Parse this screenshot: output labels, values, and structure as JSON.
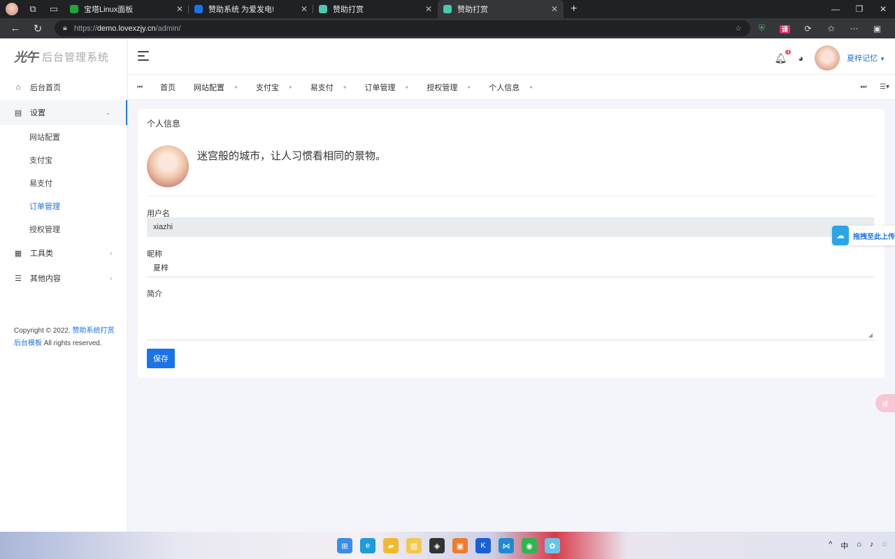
{
  "browser": {
    "tabs": [
      {
        "label": "宝塔Linux面板",
        "favicon_color": "#20a53a",
        "active": false
      },
      {
        "label": "赞助系统 为爱发电!",
        "favicon_color": "#1a73e8",
        "active": false
      },
      {
        "label": "赞助打赏",
        "favicon_color": "#48c9b0",
        "active": false
      },
      {
        "label": "赞助打赏",
        "favicon_color": "#48c9b0",
        "active": true
      }
    ],
    "url_scheme": "https://",
    "url_host": "demo.lovexzjy.cn",
    "url_path": "/admin/",
    "new_tab": "+",
    "translate_ext": "译"
  },
  "sidebar": {
    "logo": "光午",
    "brand": "后台管理系统",
    "items": [
      {
        "label": "后台首页",
        "icon": "dashboard-icon"
      },
      {
        "label": "设置",
        "icon": "settings-icon",
        "open": true
      },
      {
        "label": "工具类",
        "icon": "tools-icon"
      },
      {
        "label": "其他内容",
        "icon": "list-icon"
      }
    ],
    "subitems": [
      {
        "label": "网站配置",
        "active": false
      },
      {
        "label": "支付宝",
        "active": false
      },
      {
        "label": "易支付",
        "active": false
      },
      {
        "label": "订单管理",
        "active": true
      },
      {
        "label": "授权管理",
        "active": false
      }
    ],
    "copyright_prefix": "Copyright © 2022.",
    "copyright_link": "赞助系统打赏后台模板",
    "copyright_suffix": "All rights reserved."
  },
  "topbar": {
    "notif_count": "1",
    "username": "夏梓记忆"
  },
  "page_tabs": [
    "首页",
    "网站配置",
    "支付宝",
    "易支付",
    "订单管理",
    "授权管理",
    "个人信息"
  ],
  "card": {
    "title": "个人信息",
    "motto": "迷宫般的城市，让人习惯看相同的景物。",
    "fields": {
      "username_label": "用户名",
      "username_value": "xiazhi",
      "nickname_label": "昵称",
      "nickname_value": "夏梓",
      "intro_label": "简介",
      "intro_value": ""
    },
    "save_label": "保存"
  },
  "floats": {
    "upload_label": "拖拽至此上传",
    "translate_label": "译"
  },
  "taskbar": {
    "ime": "中"
  }
}
